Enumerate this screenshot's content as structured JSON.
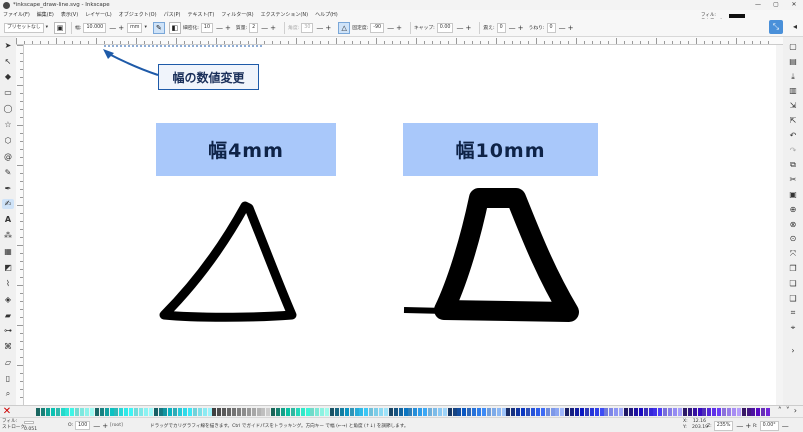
{
  "window": {
    "title": "*inkscape_draw-line.svg - Inkscape",
    "controls": [
      "—",
      "▢",
      "✕"
    ]
  },
  "menu": {
    "items": [
      "ファイル(F)",
      "編集(E)",
      "表示(V)",
      "レイヤー(L)",
      "オブジェクト(O)",
      "パス(P)",
      "テキスト(T)",
      "フィルター(R)",
      "エクステンション(N)",
      "ヘルプ(H)"
    ],
    "fill_label": "フィル:",
    "stroke_label": "ストローク:"
  },
  "toolbar": {
    "preset": "プリセットなし",
    "width_label": "幅:",
    "width_value": "10.000",
    "unit": "mm",
    "thinning_label": "細密化:",
    "thinning_value": "10",
    "mass_label": "質量:",
    "mass_value": "2",
    "angle_label": "角度:",
    "angle_value": "30",
    "fixation_label": "固定度:",
    "fixation_value": "-90",
    "caps_label": "キャップ:",
    "caps_value": "0.00",
    "tremor_label": "震え:",
    "tremor_value": "0",
    "wiggle_label": "うねり:",
    "wiggle_value": "0"
  },
  "canvas": {
    "callout": "幅の数値変更",
    "label_left": "幅4mm",
    "label_right": "幅10mm",
    "colors": {
      "label_bg": "#a9c8fa",
      "callout_border": "#1e5aa8",
      "arrow": "#1e5aa8",
      "stroke": "#000000"
    }
  },
  "status": {
    "fill_label": "フィル:",
    "stroke_label": "ストローク:",
    "stroke_width": "0.051",
    "opacity_label": "O:",
    "opacity_value": "100",
    "layer": "[root]",
    "message": "ドラッグでカリグラフィ線を描きます。Ctrl でガイドパスをトラッキング。方向キー で幅 (←→) と角度 (↑↓) を調節します。",
    "x_label": "X:",
    "y_label": "Y:",
    "x_value": "12.16",
    "y_value": "203.19",
    "zoom_label": "Z:",
    "zoom_value": "235%",
    "rotate_label": "R:",
    "rotate_value": "0.00°"
  },
  "tools_left": [
    "select-icon",
    "node-icon",
    "tweak-icon",
    "zoom-icon",
    "rect-icon",
    "circle-icon",
    "star-icon",
    "3dbox-icon",
    "spiral-icon",
    "pencil-icon",
    "pen-icon",
    "calligraphy-icon",
    "text-icon",
    "spray-icon",
    "mesh-icon",
    "gradient-icon",
    "dropper-icon",
    "paintbucket-icon",
    "eraser-icon",
    "connector-icon",
    "lpe-icon",
    "measure-icon",
    "pages-icon",
    "zoom-tool-icon"
  ],
  "commands_right": [
    "new-doc-icon",
    "open-icon",
    "save-icon",
    "print-icon",
    "import-icon",
    "export-icon",
    "undo-icon",
    "redo-icon",
    "copy-icon",
    "cut-icon",
    "paste-icon",
    "zoom-selection-icon",
    "zoom-drawing-icon",
    "zoom-page-icon",
    "zoom-center-icon",
    "duplicate-icon",
    "clone-icon",
    "unlink-icon",
    "group-icon",
    "ungroup-icon"
  ]
}
